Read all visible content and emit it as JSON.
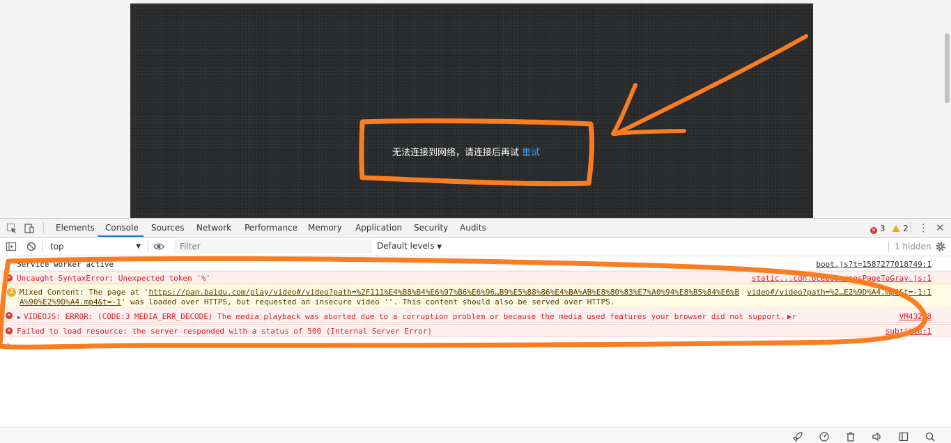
{
  "video": {
    "message": "无法连接到网络，请连接后再试",
    "retry_label": "重试"
  },
  "devtools": {
    "tabs": [
      {
        "label": "Elements"
      },
      {
        "label": "Console",
        "active": true
      },
      {
        "label": "Sources"
      },
      {
        "label": "Network"
      },
      {
        "label": "Performance"
      },
      {
        "label": "Memory"
      },
      {
        "label": "Application"
      },
      {
        "label": "Security"
      },
      {
        "label": "Audits"
      }
    ],
    "error_count": "3",
    "warning_count": "2",
    "icons": [
      "inspect-icon",
      "device-toolbar-icon",
      "kebab-menu-icon",
      "close-icon"
    ]
  },
  "toolbar": {
    "context": "top",
    "filter_placeholder": "Filter",
    "levels_label": "Default levels",
    "hidden_label": "1 hidden"
  },
  "console": {
    "messages": [
      {
        "level": "log",
        "text": "Service worker active",
        "source": "boot.js?t=1587277018749:1"
      },
      {
        "level": "error",
        "text": "Uncaught SyntaxError: Unexpected token '%'",
        "source": "static...cdn.bcebos…ransPageToGray.js:1"
      },
      {
        "level": "warning",
        "badge": "2",
        "text_prefix": "Mixed Content: The page at '",
        "url_line1": "https://pan.baidu.com/play/video#/video?path=%2F111%E4%B8%B4%E6%97%B6%E6%96…B9%E5%88%86%E4%BA%AB%E8%80%83%E7%A0%94%E8%B5%84%E6%B",
        "url_line2": "A%90%E2%9D%A4.mp4&t=-1",
        "text_suffix": "' was loaded over HTTPS, but requested an insecure video ''. This content should also be served over HTTPS.",
        "source": "video#/video?path=%2…E2%9D%A4.mp4&t=-1:1"
      },
      {
        "level": "error",
        "text": "VIDEOJS: ERROR: (CODE:3 MEDIA_ERR_DECODE) The media playback was aborted due to a corruption problem or because the media used features your browser did not support.",
        "expander": "▶r",
        "source": "VM432:8"
      },
      {
        "level": "error",
        "text": "Failed to load resource: the server responded with a status of 500 (Internal Server Error)",
        "source": "subtitle:1"
      }
    ],
    "prompt": "›"
  },
  "bottom_bar": {
    "icons": [
      "rocket-icon",
      "speed-icon",
      "trash-icon",
      "volume-icon",
      "window-icon",
      "search-icon"
    ]
  },
  "colors": {
    "annotation_orange": "#fb7d22",
    "tab_active_underline": "#1a73e8",
    "error_text": "#e02020",
    "error_background": "#fff0f0",
    "warning_background": "#fffbe5",
    "retry_link": "#3a9bf0"
  }
}
